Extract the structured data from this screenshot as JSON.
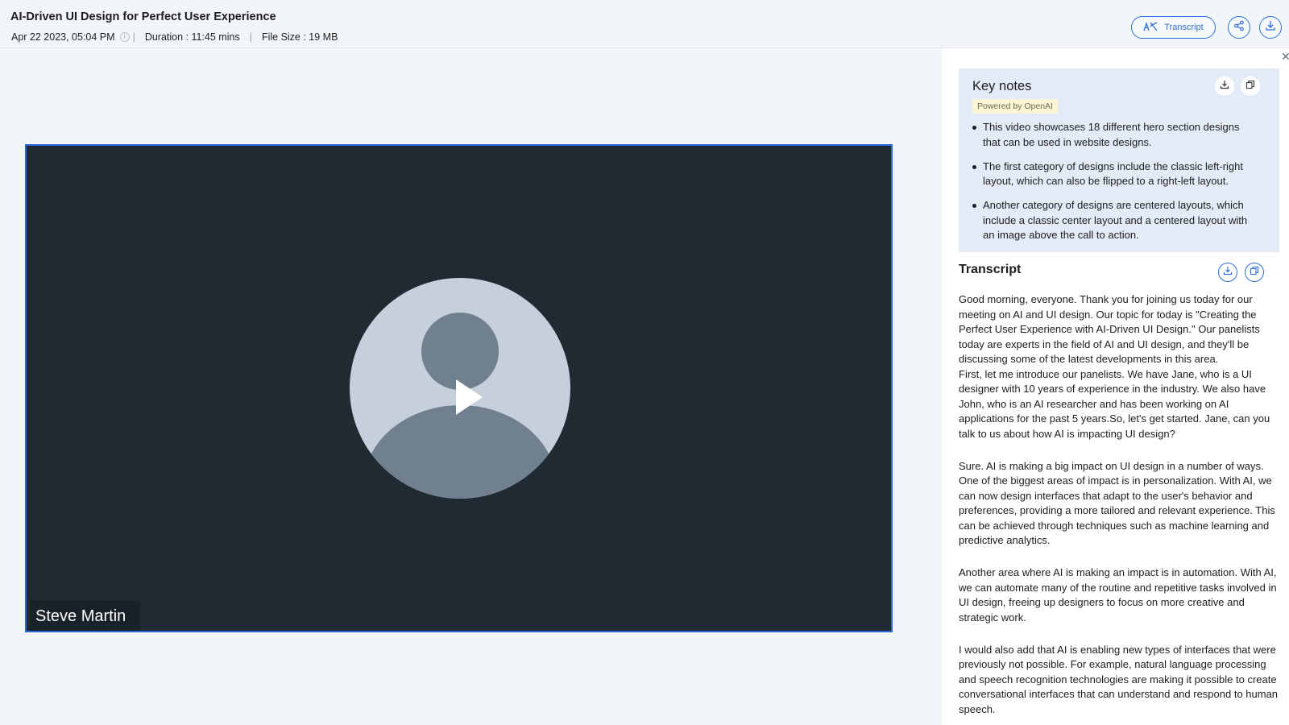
{
  "header": {
    "title": "AI-Driven UI Design for Perfect User Experience",
    "date": "Apr 22 2023, 05:04 PM",
    "duration": "Duration : 11:45 mins",
    "file_size": "File Size : 19 MB",
    "transcript_button": "Transcript",
    "icons": [
      "transcript-icon",
      "share-icon",
      "download-icon",
      "info-icon"
    ]
  },
  "video": {
    "speaker_name": "Steve Martin",
    "state": "paused"
  },
  "key_notes": {
    "title": "Key notes",
    "badge": "Powered by OpenAI",
    "items": [
      "This video showcases 18 different hero section designs that can be used in website designs.",
      "The first category of designs include the classic left-right layout, which can also be flipped to a right-left layout.",
      "Another category of designs are centered layouts, which include a classic center layout and a centered layout with an image above the call to action."
    ]
  },
  "transcript": {
    "title": "Transcript",
    "paragraphs": [
      "Good morning, everyone. Thank you for joining us today for our meeting on AI and UI design. Our topic for today is \"Creating the Perfect User Experience with AI-Driven UI Design.\" Our panelists today are experts in the field of AI and UI design, and they'll be discussing some of the latest developments in this area.",
      "First, let me introduce our panelists. We have Jane, who is a UI designer with 10 years of experience in the industry. We also have John, who is an AI researcher and has been working on AI applications for the past 5 years.So, let's get started. Jane, can you talk to us about how AI is impacting UI design?",
      "Sure. AI is making a big impact on UI design in a number of ways. One of the biggest areas of impact is in personalization. With AI, we can now design interfaces that adapt to the user's behavior and preferences, providing a more tailored and relevant experience. This can be achieved through techniques such as machine learning and predictive analytics.",
      "Another area where AI is making an impact is in automation. With AI, we can automate many of the routine and repetitive tasks involved in UI design, freeing up designers to focus on more creative and strategic work.",
      "I would also add that AI is enabling new types of interfaces that were previously not possible. For example, natural language processing and speech recognition technologies are making it possible to create conversational interfaces that can understand and respond to human speech."
    ]
  },
  "colors": {
    "accent": "#2f6fd7",
    "video_bg": "#202a33",
    "keynotes_bg": "#e3ebf7",
    "badge_bg": "#fbf5d3"
  }
}
